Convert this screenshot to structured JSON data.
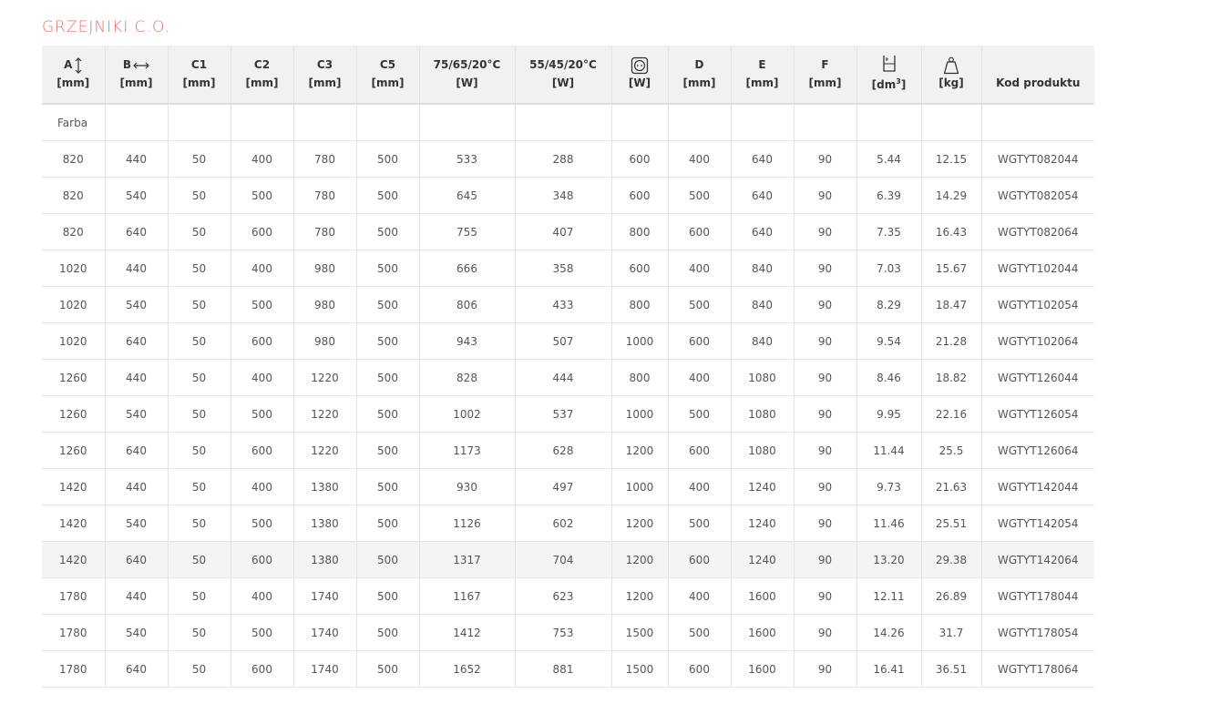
{
  "page_title": "GRZEJNIKI C.O.",
  "table": {
    "headers": [
      {
        "label": "A",
        "unit": "[mm]",
        "icon": "vertical-arrow-icon"
      },
      {
        "label": "B",
        "unit": "[mm]",
        "icon": "horizontal-arrow-icon"
      },
      {
        "label": "C1",
        "unit": "[mm]"
      },
      {
        "label": "C2",
        "unit": "[mm]"
      },
      {
        "label": "C3",
        "unit": "[mm]"
      },
      {
        "label": "C5",
        "unit": "[mm]"
      },
      {
        "label": "75/65/20°C",
        "unit": "[W]"
      },
      {
        "label": "55/45/20°C",
        "unit": "[W]"
      },
      {
        "label": "",
        "unit": "[W]",
        "icon": "power-socket-icon"
      },
      {
        "label": "D",
        "unit": "[mm]"
      },
      {
        "label": "E",
        "unit": "[mm]"
      },
      {
        "label": "F",
        "unit": "[mm]"
      },
      {
        "label": "",
        "unit": "[dm3]",
        "icon": "water-capacity-icon"
      },
      {
        "label": "",
        "unit": "[kg]",
        "icon": "weight-icon"
      },
      {
        "label": "",
        "unit": "Kod produktu"
      }
    ],
    "group_label": "Farba",
    "rows": [
      [
        "820",
        "440",
        "50",
        "400",
        "780",
        "500",
        "533",
        "288",
        "600",
        "400",
        "640",
        "90",
        "5.44",
        "12.15",
        "WGTYT082044"
      ],
      [
        "820",
        "540",
        "50",
        "500",
        "780",
        "500",
        "645",
        "348",
        "600",
        "500",
        "640",
        "90",
        "6.39",
        "14.29",
        "WGTYT082054"
      ],
      [
        "820",
        "640",
        "50",
        "600",
        "780",
        "500",
        "755",
        "407",
        "800",
        "600",
        "640",
        "90",
        "7.35",
        "16.43",
        "WGTYT082064"
      ],
      [
        "1020",
        "440",
        "50",
        "400",
        "980",
        "500",
        "666",
        "358",
        "600",
        "400",
        "840",
        "90",
        "7.03",
        "15.67",
        "WGTYT102044"
      ],
      [
        "1020",
        "540",
        "50",
        "500",
        "980",
        "500",
        "806",
        "433",
        "800",
        "500",
        "840",
        "90",
        "8.29",
        "18.47",
        "WGTYT102054"
      ],
      [
        "1020",
        "640",
        "50",
        "600",
        "980",
        "500",
        "943",
        "507",
        "1000",
        "600",
        "840",
        "90",
        "9.54",
        "21.28",
        "WGTYT102064"
      ],
      [
        "1260",
        "440",
        "50",
        "400",
        "1220",
        "500",
        "828",
        "444",
        "800",
        "400",
        "1080",
        "90",
        "8.46",
        "18.82",
        "WGTYT126044"
      ],
      [
        "1260",
        "540",
        "50",
        "500",
        "1220",
        "500",
        "1002",
        "537",
        "1000",
        "500",
        "1080",
        "90",
        "9.95",
        "22.16",
        "WGTYT126054"
      ],
      [
        "1260",
        "640",
        "50",
        "600",
        "1220",
        "500",
        "1173",
        "628",
        "1200",
        "600",
        "1080",
        "90",
        "11.44",
        "25.5",
        "WGTYT126064"
      ],
      [
        "1420",
        "440",
        "50",
        "400",
        "1380",
        "500",
        "930",
        "497",
        "1000",
        "400",
        "1240",
        "90",
        "9.73",
        "21.63",
        "WGTYT142044"
      ],
      [
        "1420",
        "540",
        "50",
        "500",
        "1380",
        "500",
        "1126",
        "602",
        "1200",
        "500",
        "1240",
        "90",
        "11.46",
        "25.51",
        "WGTYT142054"
      ],
      [
        "1420",
        "640",
        "50",
        "600",
        "1380",
        "500",
        "1317",
        "704",
        "1200",
        "600",
        "1240",
        "90",
        "13.20",
        "29.38",
        "WGTYT142064"
      ],
      [
        "1780",
        "440",
        "50",
        "400",
        "1740",
        "500",
        "1167",
        "623",
        "1200",
        "400",
        "1600",
        "90",
        "12.11",
        "26.89",
        "WGTYT178044"
      ],
      [
        "1780",
        "540",
        "50",
        "500",
        "1740",
        "500",
        "1412",
        "753",
        "1500",
        "500",
        "1600",
        "90",
        "14.26",
        "31.7",
        "WGTYT178054"
      ],
      [
        "1780",
        "640",
        "50",
        "600",
        "1740",
        "500",
        "1652",
        "881",
        "1500",
        "600",
        "1600",
        "90",
        "16.41",
        "36.51",
        "WGTYT178064"
      ]
    ],
    "highlighted_row": 11,
    "colors": {
      "title": "#e8706a",
      "header_bg": "#f1f1f1",
      "hover_row_bg": "#f4f4f4",
      "border": "#e3e3e3"
    }
  }
}
